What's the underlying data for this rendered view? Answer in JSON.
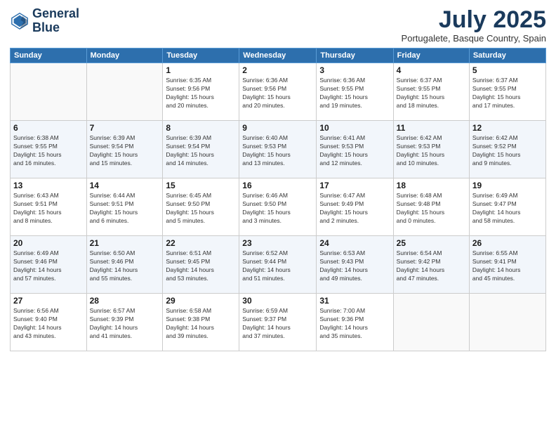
{
  "logo": {
    "line1": "General",
    "line2": "Blue"
  },
  "title": "July 2025",
  "location": "Portugalete, Basque Country, Spain",
  "weekdays": [
    "Sunday",
    "Monday",
    "Tuesday",
    "Wednesday",
    "Thursday",
    "Friday",
    "Saturday"
  ],
  "weeks": [
    [
      {
        "day": "",
        "info": ""
      },
      {
        "day": "",
        "info": ""
      },
      {
        "day": "1",
        "info": "Sunrise: 6:35 AM\nSunset: 9:56 PM\nDaylight: 15 hours\nand 20 minutes."
      },
      {
        "day": "2",
        "info": "Sunrise: 6:36 AM\nSunset: 9:56 PM\nDaylight: 15 hours\nand 20 minutes."
      },
      {
        "day": "3",
        "info": "Sunrise: 6:36 AM\nSunset: 9:55 PM\nDaylight: 15 hours\nand 19 minutes."
      },
      {
        "day": "4",
        "info": "Sunrise: 6:37 AM\nSunset: 9:55 PM\nDaylight: 15 hours\nand 18 minutes."
      },
      {
        "day": "5",
        "info": "Sunrise: 6:37 AM\nSunset: 9:55 PM\nDaylight: 15 hours\nand 17 minutes."
      }
    ],
    [
      {
        "day": "6",
        "info": "Sunrise: 6:38 AM\nSunset: 9:55 PM\nDaylight: 15 hours\nand 16 minutes."
      },
      {
        "day": "7",
        "info": "Sunrise: 6:39 AM\nSunset: 9:54 PM\nDaylight: 15 hours\nand 15 minutes."
      },
      {
        "day": "8",
        "info": "Sunrise: 6:39 AM\nSunset: 9:54 PM\nDaylight: 15 hours\nand 14 minutes."
      },
      {
        "day": "9",
        "info": "Sunrise: 6:40 AM\nSunset: 9:53 PM\nDaylight: 15 hours\nand 13 minutes."
      },
      {
        "day": "10",
        "info": "Sunrise: 6:41 AM\nSunset: 9:53 PM\nDaylight: 15 hours\nand 12 minutes."
      },
      {
        "day": "11",
        "info": "Sunrise: 6:42 AM\nSunset: 9:53 PM\nDaylight: 15 hours\nand 10 minutes."
      },
      {
        "day": "12",
        "info": "Sunrise: 6:42 AM\nSunset: 9:52 PM\nDaylight: 15 hours\nand 9 minutes."
      }
    ],
    [
      {
        "day": "13",
        "info": "Sunrise: 6:43 AM\nSunset: 9:51 PM\nDaylight: 15 hours\nand 8 minutes."
      },
      {
        "day": "14",
        "info": "Sunrise: 6:44 AM\nSunset: 9:51 PM\nDaylight: 15 hours\nand 6 minutes."
      },
      {
        "day": "15",
        "info": "Sunrise: 6:45 AM\nSunset: 9:50 PM\nDaylight: 15 hours\nand 5 minutes."
      },
      {
        "day": "16",
        "info": "Sunrise: 6:46 AM\nSunset: 9:50 PM\nDaylight: 15 hours\nand 3 minutes."
      },
      {
        "day": "17",
        "info": "Sunrise: 6:47 AM\nSunset: 9:49 PM\nDaylight: 15 hours\nand 2 minutes."
      },
      {
        "day": "18",
        "info": "Sunrise: 6:48 AM\nSunset: 9:48 PM\nDaylight: 15 hours\nand 0 minutes."
      },
      {
        "day": "19",
        "info": "Sunrise: 6:49 AM\nSunset: 9:47 PM\nDaylight: 14 hours\nand 58 minutes."
      }
    ],
    [
      {
        "day": "20",
        "info": "Sunrise: 6:49 AM\nSunset: 9:46 PM\nDaylight: 14 hours\nand 57 minutes."
      },
      {
        "day": "21",
        "info": "Sunrise: 6:50 AM\nSunset: 9:46 PM\nDaylight: 14 hours\nand 55 minutes."
      },
      {
        "day": "22",
        "info": "Sunrise: 6:51 AM\nSunset: 9:45 PM\nDaylight: 14 hours\nand 53 minutes."
      },
      {
        "day": "23",
        "info": "Sunrise: 6:52 AM\nSunset: 9:44 PM\nDaylight: 14 hours\nand 51 minutes."
      },
      {
        "day": "24",
        "info": "Sunrise: 6:53 AM\nSunset: 9:43 PM\nDaylight: 14 hours\nand 49 minutes."
      },
      {
        "day": "25",
        "info": "Sunrise: 6:54 AM\nSunset: 9:42 PM\nDaylight: 14 hours\nand 47 minutes."
      },
      {
        "day": "26",
        "info": "Sunrise: 6:55 AM\nSunset: 9:41 PM\nDaylight: 14 hours\nand 45 minutes."
      }
    ],
    [
      {
        "day": "27",
        "info": "Sunrise: 6:56 AM\nSunset: 9:40 PM\nDaylight: 14 hours\nand 43 minutes."
      },
      {
        "day": "28",
        "info": "Sunrise: 6:57 AM\nSunset: 9:39 PM\nDaylight: 14 hours\nand 41 minutes."
      },
      {
        "day": "29",
        "info": "Sunrise: 6:58 AM\nSunset: 9:38 PM\nDaylight: 14 hours\nand 39 minutes."
      },
      {
        "day": "30",
        "info": "Sunrise: 6:59 AM\nSunset: 9:37 PM\nDaylight: 14 hours\nand 37 minutes."
      },
      {
        "day": "31",
        "info": "Sunrise: 7:00 AM\nSunset: 9:36 PM\nDaylight: 14 hours\nand 35 minutes."
      },
      {
        "day": "",
        "info": ""
      },
      {
        "day": "",
        "info": ""
      }
    ]
  ]
}
